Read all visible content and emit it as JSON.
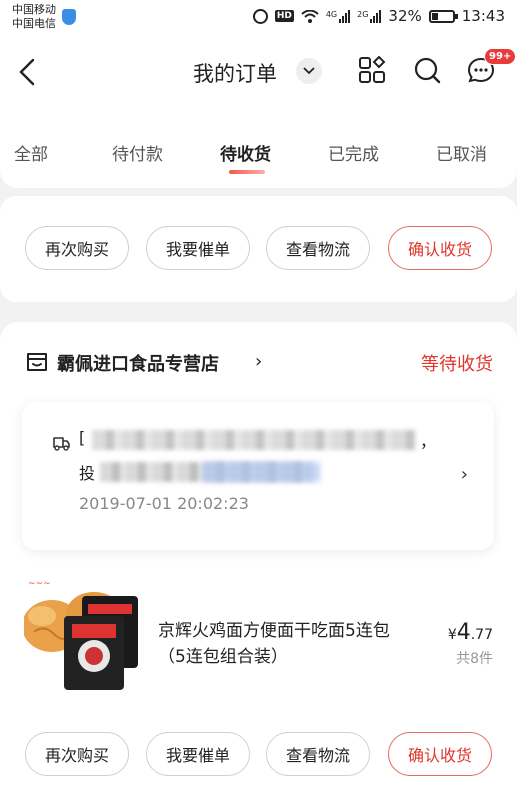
{
  "status_bar": {
    "carrier1": "中国移动",
    "carrier2": "中国电信",
    "net1": "4G",
    "net2": "2G",
    "hd": "HD",
    "battery": "32%",
    "time": "13:43"
  },
  "header": {
    "title": "我的订单",
    "badge": "99+"
  },
  "tabs": [
    "全部",
    "待付款",
    "待收货",
    "已完成",
    "已取消"
  ],
  "active_tab": "待收货",
  "card1": {
    "buttons": [
      "再次购买",
      "我要催单",
      "查看物流",
      "确认收货"
    ]
  },
  "order": {
    "shop_name": "霸佩进口食品专营店",
    "status": "等待收货",
    "address_prefix": "[",
    "address_end": "，",
    "address_line2_prefix": "投",
    "address_time": "2019-07-01 20:02:23",
    "product_name": "京辉火鸡面方便面干吃面5连包 （5连包组合装）",
    "price_symbol": "¥",
    "price_int": "4",
    "price_dec": ".77",
    "quantity": "共8件",
    "buttons": [
      "再次购买",
      "我要催单",
      "查看物流",
      "确认收货"
    ]
  },
  "colors": {
    "accent": "#e0352b",
    "background": "#f2f2f2"
  }
}
